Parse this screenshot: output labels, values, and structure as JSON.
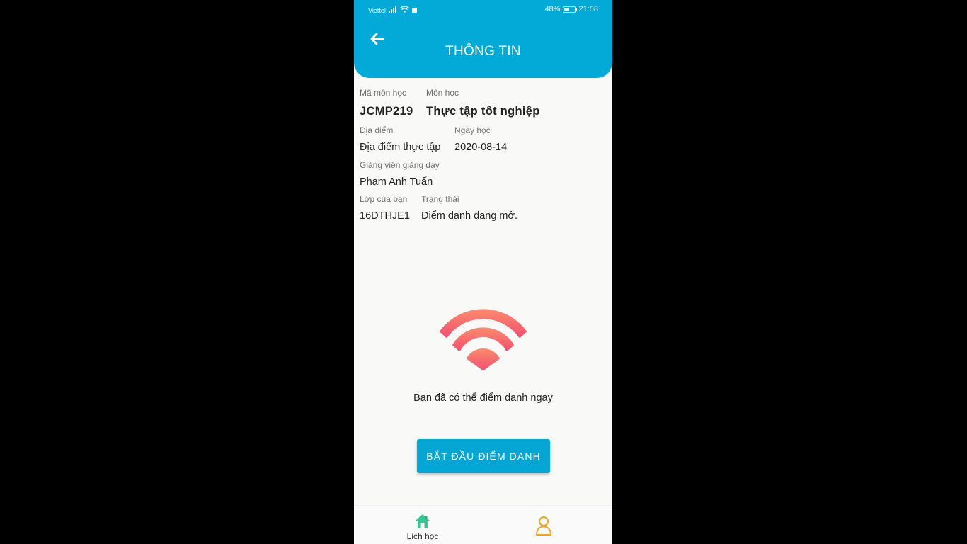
{
  "status_bar": {
    "carrier": "Viettel",
    "battery": "48%",
    "battery_level": 0.48,
    "time": "21:58"
  },
  "header": {
    "title": "THÔNG TIN",
    "back_icon": "arrow-left-icon",
    "color": "#04aad7"
  },
  "info": {
    "course_code_label": "Mã môn học",
    "course_code": "JCMP219",
    "course_name_label": "Môn học",
    "course_name": "Thực tập tốt nghiệp",
    "location_label": "Địa điểm",
    "location": "Địa điểm thực tập",
    "date_label": "Ngày học",
    "date": "2020-08-14",
    "lecturer_label": "Giảng viên giảng dạy",
    "lecturer": "Phạm Anh Tuấn",
    "class_label": "Lớp của bạn",
    "class": "16DTHJE1",
    "status_label": "Trạng thái",
    "status": "Điểm danh đang mở."
  },
  "attendance": {
    "icon": "wifi-icon",
    "message": "Bạn đã có thể điểm danh ngay",
    "button_label": "BẮT ĐẦU ĐIỂM DANH",
    "button_color": "#05a6d4"
  },
  "bottom_nav": {
    "items": [
      {
        "label": "Lịch học",
        "icon": "home-icon"
      },
      {
        "label": "",
        "icon": "user-icon"
      }
    ]
  }
}
